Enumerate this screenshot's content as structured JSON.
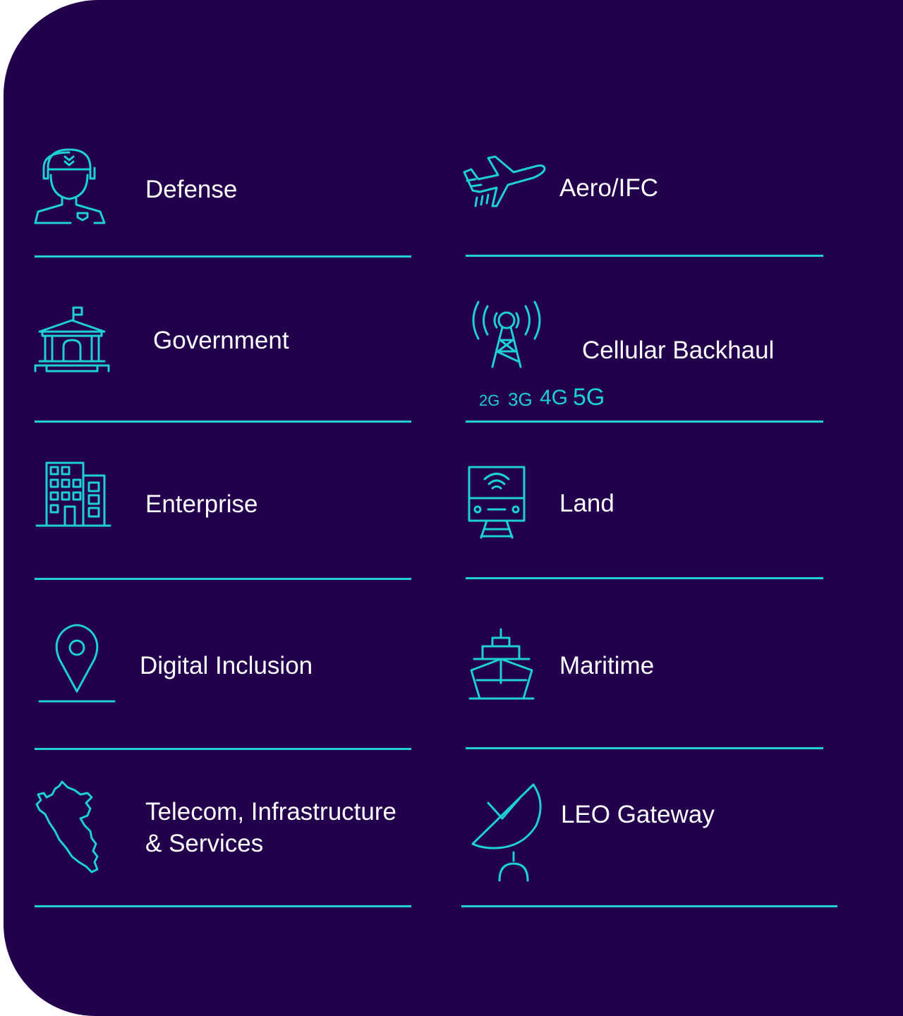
{
  "accent_color": "#1ecfd6",
  "background_color": "#22004b",
  "segments": {
    "defense": {
      "label": "Defense",
      "icon": "soldier-icon"
    },
    "aero": {
      "label": "Aero/IFC",
      "icon": "airplane-icon"
    },
    "government": {
      "label": "Government",
      "icon": "government-building-icon"
    },
    "cellular": {
      "label": "Cellular Backhaul",
      "icon": "cell-tower-icon",
      "generations": [
        "2G",
        "3G",
        "4G",
        "5G"
      ]
    },
    "enterprise": {
      "label": "Enterprise",
      "icon": "office-buildings-icon"
    },
    "land": {
      "label": "Land",
      "icon": "train-icon"
    },
    "digital_inclusion": {
      "label": "Digital Inclusion",
      "icon": "location-pin-icon"
    },
    "maritime": {
      "label": "Maritime",
      "icon": "ship-icon"
    },
    "telecom": {
      "label_line1": "Telecom, Infrastructure",
      "label_line2": "& Services",
      "icon": "peru-map-icon"
    },
    "leo": {
      "label": "LEO Gateway",
      "icon": "satellite-dish-icon"
    }
  }
}
